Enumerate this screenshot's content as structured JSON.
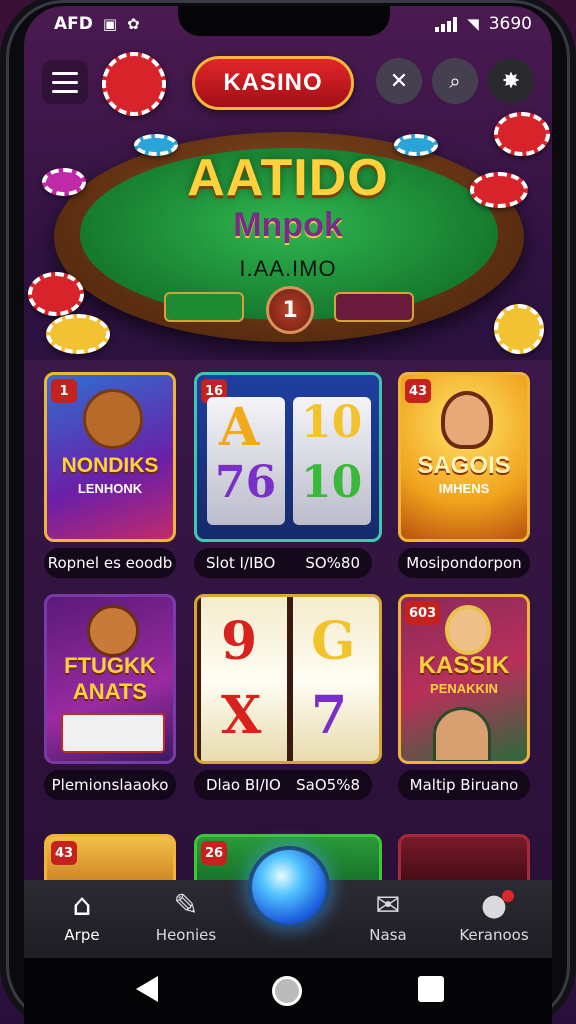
{
  "status_bar": {
    "left_text": "AFD",
    "time": "3690"
  },
  "header": {
    "logo": "KASINO"
  },
  "hero": {
    "title": "AATIDO",
    "subtitle": "Mnpok",
    "caption": "I.AA.IMO",
    "table_number": "1"
  },
  "games": [
    {
      "badge": "1",
      "title": "NONDIKS",
      "subtitle": "LENHONK",
      "label": "Ropnel es eoodb"
    },
    {
      "badge": "16",
      "reels": [
        "A",
        "10",
        "76",
        "10"
      ],
      "label_left": "Slot I/IBO",
      "label_right": "SO%80"
    },
    {
      "badge": "43",
      "title": "SAGOIS",
      "subtitle": "IMHENS",
      "label": "Mosipondorpon"
    },
    {
      "badge": "",
      "title": "FTUGKK ANATS",
      "subtitle": "",
      "label": "Plemionslaaoko"
    },
    {
      "badge": "",
      "reels": [
        "9",
        "G",
        "X",
        "7"
      ],
      "label_left": "Dlao BI/IO",
      "label_right": "SaO5%8"
    },
    {
      "badge": "603",
      "title": "KASSIK",
      "subtitle": "PENAKKIN",
      "label": "Maltip Biruano"
    },
    {
      "badge": "43"
    },
    {
      "badge": "26"
    },
    {
      "badge": ""
    }
  ],
  "bottom_nav": {
    "items": [
      {
        "label": "Arpe",
        "icon": "home-icon"
      },
      {
        "label": "Heonies",
        "icon": "pen-icon"
      },
      {
        "label": "Nasa",
        "icon": "mail-icon"
      },
      {
        "label": "Keranoos",
        "icon": "chat-icon"
      }
    ]
  },
  "colors": {
    "accent_gold": "#f0b43a",
    "accent_red": "#c5221e",
    "felt_green": "#2fb64f",
    "orb_blue": "#51c3ff"
  }
}
